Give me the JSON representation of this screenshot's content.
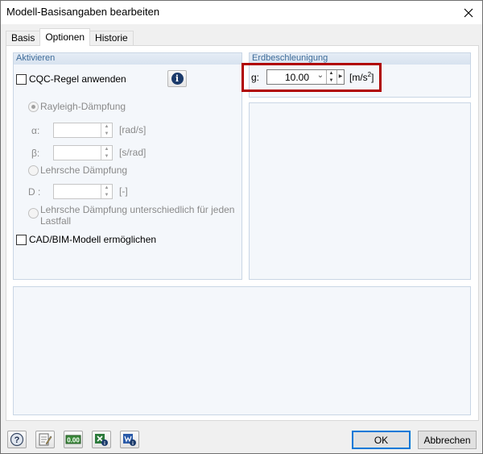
{
  "window": {
    "title": "Modell-Basisangaben bearbeiten",
    "close_icon": "close-icon"
  },
  "tabs": [
    {
      "label": "Basis"
    },
    {
      "label": "Optionen"
    },
    {
      "label": "Historie"
    }
  ],
  "aktivieren": {
    "header": "Aktivieren",
    "cqc_label": "CQC-Regel anwenden",
    "rayleigh_label": "Rayleigh-Dämpfung",
    "alpha_label": "α:",
    "alpha_unit": "[rad/s]",
    "beta_label": "β:",
    "beta_unit": "[s/rad]",
    "lehrsche_label": "Lehrsche Dämpfung",
    "d_label": "D :",
    "d_unit": "[-]",
    "lehrsche_lf_label_1": "Lehrsche Dämpfung unterschiedlich für jeden",
    "lehrsche_lf_label_2": "Lastfall",
    "cadbim_label": "CAD/BIM-Modell ermöglichen"
  },
  "erdbeschleunigung": {
    "header": "Erdbeschleunigung",
    "g_label": "g:",
    "g_value": "10.00",
    "unit_main": "[m/s",
    "unit_sup": "2",
    "unit_end": "]"
  },
  "buttons": {
    "ok": "OK",
    "cancel": "Abbrechen"
  },
  "colors": {
    "highlight": "#b00000",
    "group_header_text": "#3d6b99"
  }
}
